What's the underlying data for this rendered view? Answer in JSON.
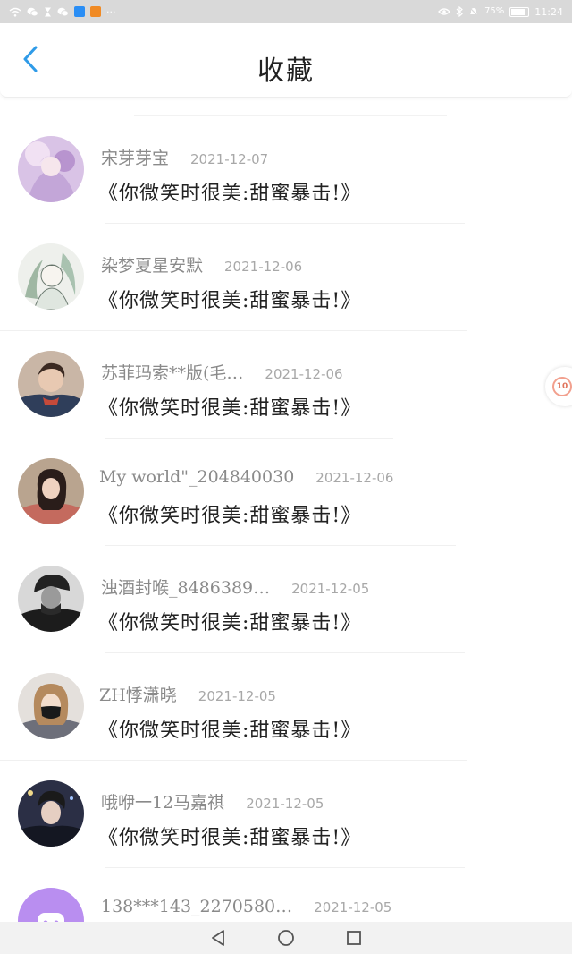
{
  "status_bar": {
    "battery": "75%",
    "time": "11:24",
    "more_glyph": "···",
    "app_icon_colors": [
      "#2a8ef5",
      "#f08a24"
    ]
  },
  "header": {
    "title": "收藏",
    "back_icon": "chevron-left-icon",
    "accent_color": "#2f9be8"
  },
  "items": [
    {
      "name": "宋芽芽宝",
      "date": "2021-12-07",
      "title": "《你微笑时很美:甜蜜暴击!》",
      "avatar": "girl-art-avatar"
    },
    {
      "name": "染梦夏星安默",
      "date": "2021-12-06",
      "title": "《你微笑时很美:甜蜜暴击!》",
      "avatar": "sketch-avatar"
    },
    {
      "name": "苏菲玛索**版(毛…",
      "date": "2021-12-06",
      "title": "《你微笑时很美:甜蜜暴击!》",
      "avatar": "boy-photo-avatar"
    },
    {
      "name": "My world\"_204840030",
      "date": "2021-12-06",
      "title": "《你微笑时很美:甜蜜暴击!》",
      "avatar": "girl-photo-avatar"
    },
    {
      "name": "浊酒封喉_8486389…",
      "date": "2021-12-05",
      "title": "《你微笑时很美:甜蜜暴击!》",
      "avatar": "dark-photo-avatar"
    },
    {
      "name": "ZH悸潇晓",
      "date": "2021-12-05",
      "title": "《你微笑时很美:甜蜜暴击!》",
      "avatar": "mask-girl-avatar"
    },
    {
      "name": "哦咿一12马嘉祺",
      "date": "2021-12-05",
      "title": "《你微笑时很美:甜蜜暴击!》",
      "avatar": "night-boy-avatar"
    },
    {
      "name": "138***143_2270580…",
      "date": "2021-12-05",
      "title": "",
      "avatar": "purple-cartoon-avatar"
    }
  ],
  "floating_badge": {
    "text": "10"
  },
  "nav": {
    "back": "triangle-back-icon",
    "home": "circle-home-icon",
    "recents": "square-recents-icon"
  }
}
